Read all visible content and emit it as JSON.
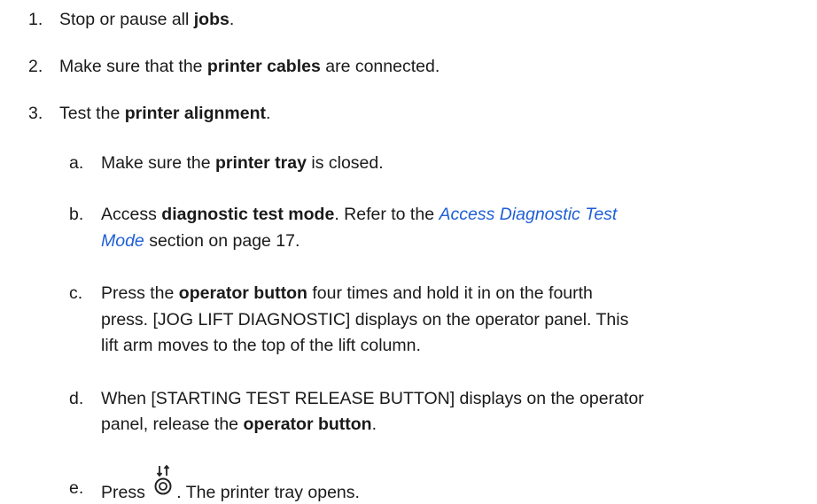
{
  "steps": [
    {
      "marker": "1.",
      "pre": "Stop or pause all ",
      "bold": "jobs",
      "post": "."
    },
    {
      "marker": "2.",
      "pre": "Make sure that the ",
      "bold": "printer cables",
      "post": " are connected."
    },
    {
      "marker": "3.",
      "pre": "Test the ",
      "bold": "printer alignment",
      "post": "."
    }
  ],
  "substeps": {
    "a": {
      "marker": "a.",
      "pre": "Make sure the ",
      "bold": "printer tray",
      "post": " is closed."
    },
    "b": {
      "marker": "b.",
      "pre": "Access ",
      "bold": "diagnostic test mode",
      "mid": ". Refer to the ",
      "link1": "Access Diagnostic Test",
      "link2": "Mode",
      "post": " section on page 17."
    },
    "c": {
      "marker": "c.",
      "pre": "Press the ",
      "bold": "operator button",
      "line1_post": " four times and hold it in on the fourth",
      "line2": "press. [JOG LIFT DIAGNOSTIC] displays on the operator panel. This",
      "line3": "lift arm moves to the top of the lift column."
    },
    "d": {
      "marker": "d.",
      "line1": "When [STARTING TEST RELEASE BUTTON] displays on the operator",
      "pre2": "panel, release the ",
      "bold": "operator button",
      "post2": "."
    },
    "e": {
      "marker": "e.",
      "pre": "Press ",
      "post": ". The printer tray opens.",
      "icon": "jog-lift-button-icon"
    }
  },
  "colors": {
    "text": "#1a1a1a",
    "link": "#1f5fd6"
  }
}
